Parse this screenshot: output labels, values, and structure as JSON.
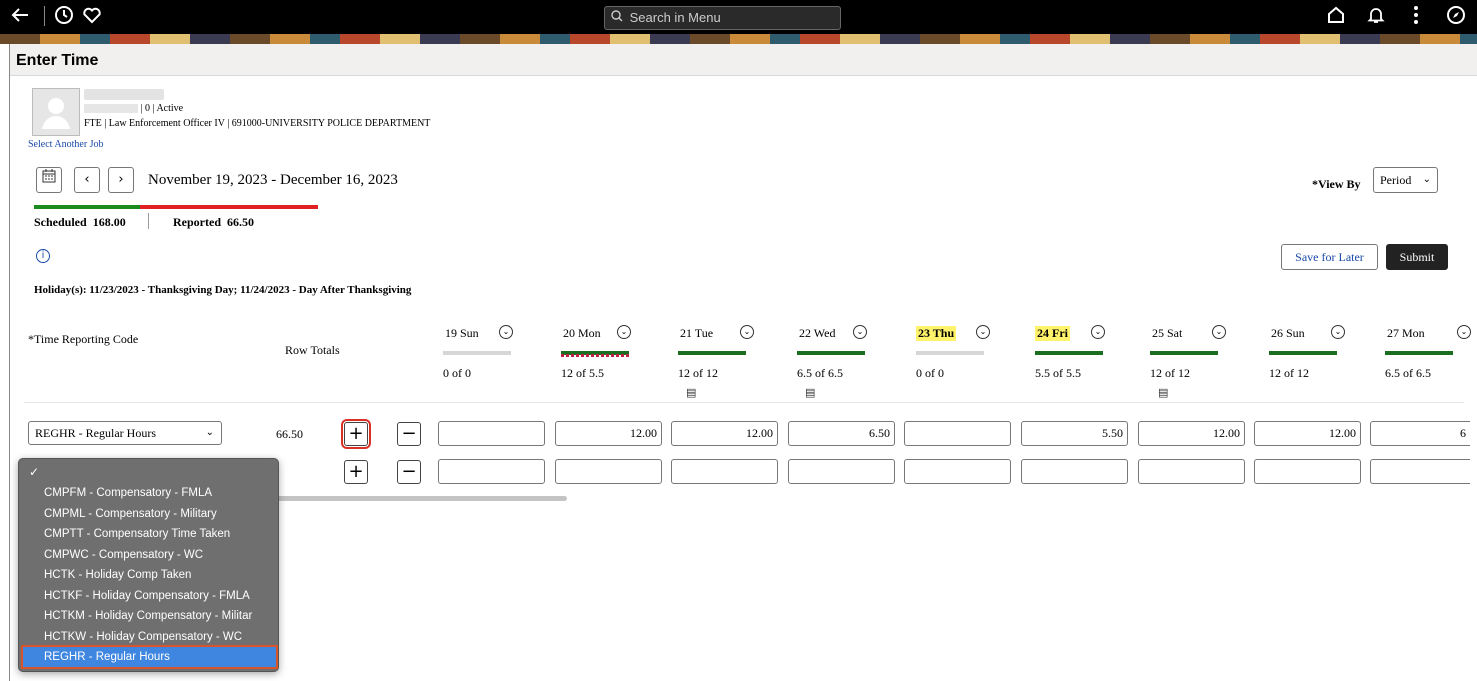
{
  "topbar": {
    "search_placeholder": "Search in Menu",
    "icons": [
      "back-arrow-icon",
      "history-icon",
      "favorites-heart-icon",
      "home-icon",
      "notification-bell-icon",
      "more-vertical-icon",
      "navbar-compass-icon"
    ]
  },
  "page": {
    "title": "Enter Time"
  },
  "employee": {
    "status": "| 0 | Active",
    "job": "FTE | Law Enforcement Officer IV | 691000-UNIVERSITY POLICE DEPARTMENT",
    "select_another_job": "Select Another Job"
  },
  "period": {
    "range": "November 19, 2023 - December 16, 2023",
    "view_by_label": "*View By",
    "view_by_value": "Period"
  },
  "summary": {
    "scheduled_label": "Scheduled",
    "scheduled_value": "168.00",
    "reported_label": "Reported",
    "reported_value": "66.50",
    "reported_fraction": 0.396
  },
  "actions": {
    "save_label": "Save for Later",
    "submit_label": "Submit"
  },
  "holiday_text": "Holiday(s): 11/23/2023 - Thanksgiving Day; 11/24/2023 - Day After Thanksgiving",
  "grid": {
    "trc_header": "*Time Reporting Code",
    "row_totals_header": "Row Totals",
    "days": [
      {
        "name": "19 Sun",
        "value": "0 of 0",
        "highlight": false,
        "bar": "none",
        "comment": false
      },
      {
        "name": "20 Mon",
        "value": "12 of 5.5",
        "highlight": false,
        "bar": "green",
        "comment": false
      },
      {
        "name": "21 Tue",
        "value": "12 of 12",
        "highlight": false,
        "bar": "green",
        "comment": true
      },
      {
        "name": "22 Wed",
        "value": "6.5 of 6.5",
        "highlight": false,
        "bar": "green",
        "comment": true
      },
      {
        "name": "23 Thu",
        "value": "0 of 0",
        "highlight": true,
        "bar": "none",
        "comment": false
      },
      {
        "name": "24 Fri",
        "value": "5.5 of 5.5",
        "highlight": true,
        "bar": "green",
        "comment": false
      },
      {
        "name": "25 Sat",
        "value": "12 of 12",
        "highlight": false,
        "bar": "green",
        "comment": true
      },
      {
        "name": "26 Sun",
        "value": "12 of 12",
        "highlight": false,
        "bar": "green",
        "comment": false
      },
      {
        "name": "27 Mon",
        "value": "6.5 of 6.5",
        "highlight": false,
        "bar": "green",
        "comment": false
      }
    ],
    "rows": [
      {
        "trc": "REGHR - Regular Hours",
        "total": "66.50",
        "cells": [
          "",
          "12.00",
          "12.00",
          "6.50",
          "",
          "5.50",
          "12.00",
          "12.00",
          "6"
        ]
      },
      {
        "trc": "",
        "total": "",
        "cells": [
          "",
          "",
          "",
          "",
          "",
          "",
          "",
          "",
          ""
        ]
      }
    ],
    "add_symbol": "+",
    "remove_symbol": "−"
  },
  "dropdown": {
    "check": "✓",
    "options": [
      "CMPFM - Compensatory - FMLA",
      "CMPML - Compensatory - Military",
      "CMPTT - Compensatory Time Taken",
      "CMPWC - Compensatory - WC",
      "HCTK - Holiday Comp Taken",
      "HCTKF - Holiday Compensatory - FMLA",
      "HCTKM - Holiday Compensatory - Militar",
      "HCTKW - Holiday Compensatory - WC",
      "REGHR - Regular Hours"
    ],
    "selected_index": 8
  },
  "colors": {
    "scheduled_bar": "#1b8a1f",
    "reported_bar": "#e02020",
    "holiday_highlight": "#fff36b",
    "submit_bg": "#222222",
    "selected_option": "#3f86e0"
  }
}
